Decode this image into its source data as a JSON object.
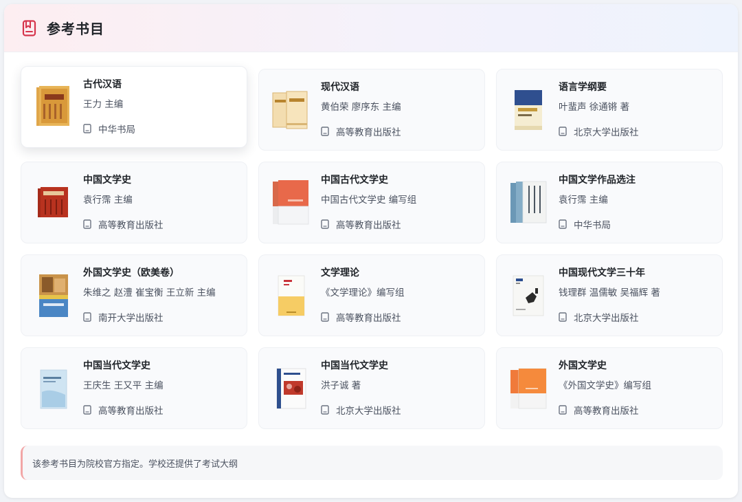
{
  "header": {
    "title": "参考书目",
    "icon": "book-icon",
    "accent": "#d6344c"
  },
  "books": [
    {
      "title": "古代汉语",
      "author": "王力 主编",
      "publisher": "中华书局",
      "cover": "cover-gudaihanyu"
    },
    {
      "title": "现代汉语",
      "author": "黄伯荣 廖序东 主编",
      "publisher": "高等教育出版社",
      "cover": "cover-xiandaihanyu"
    },
    {
      "title": "语言学纲要",
      "author": "叶蜚声 徐通锵 著",
      "publisher": "北京大学出版社",
      "cover": "cover-yuyanxue"
    },
    {
      "title": "中国文学史",
      "author": "袁行霈 主编",
      "publisher": "高等教育出版社",
      "cover": "cover-zhongguowenxueshi"
    },
    {
      "title": "中国古代文学史",
      "author": "中国古代文学史 编写组",
      "publisher": "高等教育出版社",
      "cover": "cover-gudaiwenxueshi"
    },
    {
      "title": "中国文学作品选注",
      "author": "袁行霈 主编",
      "publisher": "中华书局",
      "cover": "cover-zuopinxuanzhu"
    },
    {
      "title": "外国文学史（欧美卷）",
      "author": "朱维之 赵澧 崔宝衡 王立新 主编",
      "publisher": "南开大学出版社",
      "cover": "cover-waiguo-oumei"
    },
    {
      "title": "文学理论",
      "author": "《文学理论》编写组",
      "publisher": "高等教育出版社",
      "cover": "cover-wenxuelilun"
    },
    {
      "title": "中国现代文学三十年",
      "author": "钱理群 温儒敏 吴福辉 著",
      "publisher": "北京大学出版社",
      "cover": "cover-xiandai30"
    },
    {
      "title": "中国当代文学史",
      "author": "王庆生 王又平 主编",
      "publisher": "高等教育出版社",
      "cover": "cover-dangdai-wang"
    },
    {
      "title": "中国当代文学史",
      "author": "洪子诚 著",
      "publisher": "北京大学出版社",
      "cover": "cover-dangdai-hong"
    },
    {
      "title": "外国文学史",
      "author": "《外国文学史》编写组",
      "publisher": "高等教育出版社",
      "cover": "cover-waiguowenxueshi"
    }
  ],
  "publisher_icon": "building-icon",
  "note": "该参考书目为院校官方指定。学校还提供了考试大纲",
  "colors": {
    "note_border": "#f2a6a6",
    "card_bg": "#f9fafc"
  }
}
